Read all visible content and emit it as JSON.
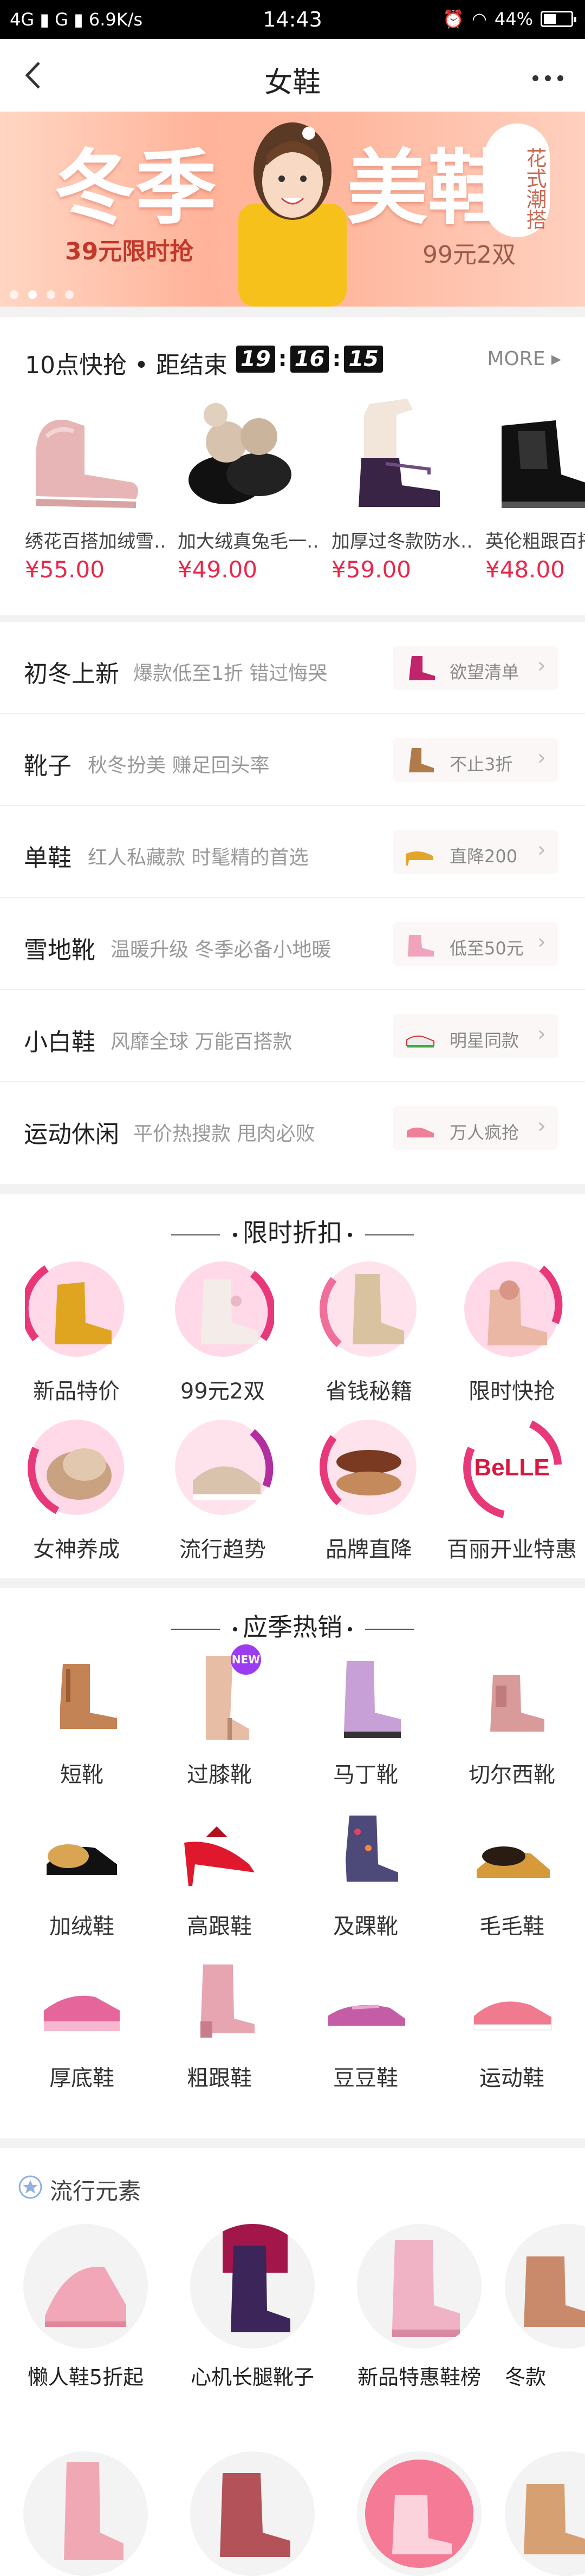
{
  "status_bar": {
    "network": "4G",
    "network2": "G",
    "speed": "6.9K/s",
    "time": "14:43",
    "battery": "44%"
  },
  "nav": {
    "title": "女鞋"
  },
  "banner": {
    "word1": "冬季",
    "word2": "美鞋",
    "promo1": "39元限时抢",
    "promo2": "99元2双",
    "tag": "花式潮搭"
  },
  "flash_sale": {
    "title": "10点快抢",
    "countdown_label": "距结束",
    "hh": "19",
    "mm": "16",
    "ss": "15",
    "more": "MORE ▸",
    "items": [
      {
        "name": "绣花百搭加绒雪…",
        "price": "¥55.00"
      },
      {
        "name": "加大绒真兔毛一…",
        "price": "¥49.00"
      },
      {
        "name": "加厚过冬款防水…",
        "price": "¥59.00"
      },
      {
        "name": "英伦粗跟百搭",
        "price": "¥48.00"
      }
    ]
  },
  "categories": [
    {
      "name": "初冬上新",
      "desc": "爆款低至1折 错过悔哭",
      "chip": "欲望清单"
    },
    {
      "name": "靴子",
      "desc": "秋冬扮美 赚足回头率",
      "chip": "不止3折"
    },
    {
      "name": "单鞋",
      "desc": "红人私藏款 时髦精的首选",
      "chip": "直降200"
    },
    {
      "name": "雪地靴",
      "desc": "温暖升级 冬季必备小地暖",
      "chip": "低至50元"
    },
    {
      "name": "小白鞋",
      "desc": "风靡全球 万能百搭款",
      "chip": "明星同款"
    },
    {
      "name": "运动休闲",
      "desc": "平价热搜款 甩肉必败",
      "chip": "万人疯抢"
    }
  ],
  "limited": {
    "title": "限时折扣",
    "items": [
      "新品特价",
      "99元2双",
      "省钱秘籍",
      "限时快抢",
      "女神养成",
      "流行趋势",
      "品牌直降",
      "百丽开业特惠"
    ],
    "brand_logo": "BeLLE"
  },
  "seasonal": {
    "title": "应季热销",
    "new_badge": "NEW",
    "items": [
      "短靴",
      "过膝靴",
      "马丁靴",
      "切尔西靴",
      "加绒鞋",
      "高跟鞋",
      "及踝靴",
      "毛毛鞋",
      "厚底鞋",
      "粗跟鞋",
      "豆豆鞋",
      "运动鞋"
    ]
  },
  "trend": {
    "title": "流行元素",
    "items": [
      "懒人鞋5折起",
      "心机长腿靴子",
      "新品特惠鞋榜",
      "冬款"
    ]
  },
  "colors": {
    "accent": "#e8284a",
    "banner": "#ffb39a"
  }
}
